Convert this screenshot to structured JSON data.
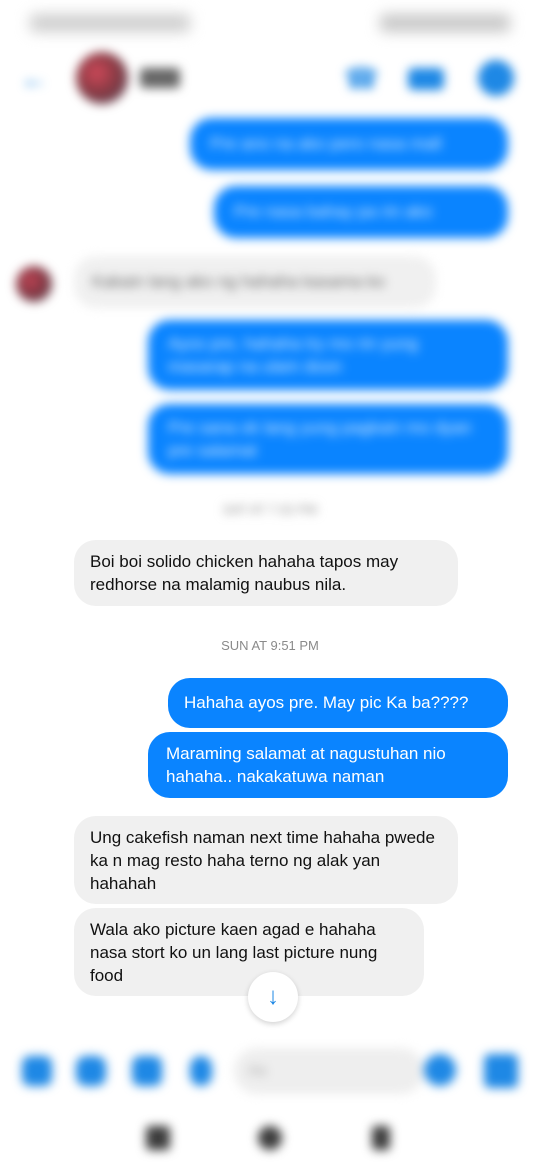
{
  "status_bar": {
    "time": "9:51 PM",
    "right": ""
  },
  "header": {
    "contact_name": "Rad"
  },
  "icons": {
    "back": "back-arrow-icon",
    "call": "phone-icon",
    "video": "video-camera-icon",
    "info": "info-icon"
  },
  "messages_blurred": [
    {
      "direction": "sent",
      "text": "Pre ano na ako pero nasa mall",
      "blurred": true
    },
    {
      "direction": "sent",
      "text": "Pre nasa bahay pa rin ako",
      "blurred": true
    },
    {
      "direction": "received",
      "text": "Kakain lang ako ng hahaha kasama ko",
      "blurred": true
    },
    {
      "direction": "sent",
      "text": "Ayos pre, hahaha try mo rin yung masarap na ulam doon",
      "blurred": true
    },
    {
      "direction": "sent",
      "text": "Pre sana ok lang yung pagkain mo dyan pre salamat",
      "blurred": true
    }
  ],
  "timestamp_blurred": "SAT AT 7:32 PM",
  "messages": [
    {
      "direction": "received",
      "text": "Boi boi solido chicken hahaha tapos may redhorse na malamig naubus nila."
    }
  ],
  "timestamp": "SUN AT 9:51 PM",
  "messages_after": [
    {
      "direction": "sent",
      "text": "Hahaha ayos pre. May pic Ka ba????"
    },
    {
      "direction": "sent",
      "text": "Maraming salamat at nagustuhan nio hahaha.. nakakatuwa naman"
    },
    {
      "direction": "received",
      "text": "Ung cakefish naman next time hahaha pwede ka n mag resto haha terno ng alak yan hahahah"
    },
    {
      "direction": "received",
      "text": "Wala ako picture kaen agad e hahaha nasa stort ko un lang last picture nung food"
    }
  ],
  "composer": {
    "placeholder": "Aa"
  },
  "colors": {
    "accent": "#0a84ff",
    "received_bubble": "#f0f0f0"
  }
}
